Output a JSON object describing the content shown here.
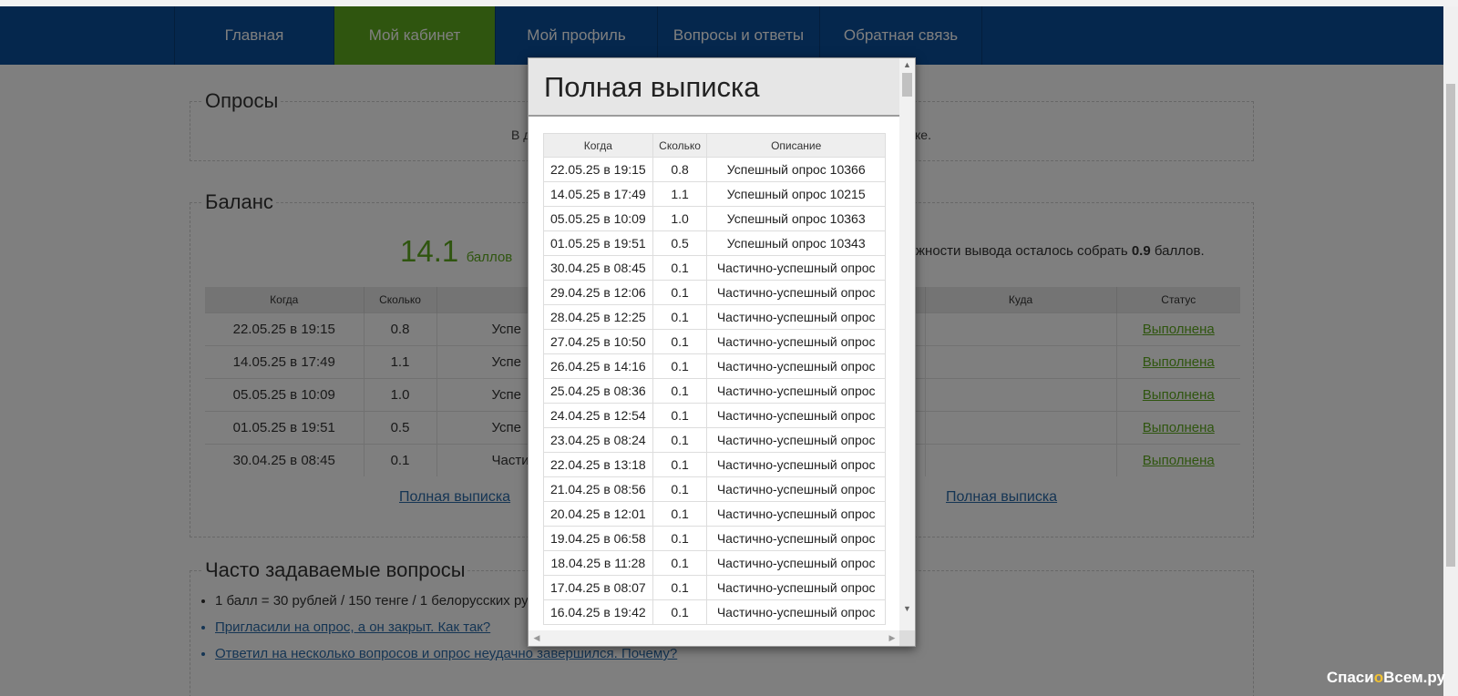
{
  "nav": [
    "Главная",
    "Мой кабинет",
    "Мой профиль",
    "Вопросы и ответы",
    "Обратная связь"
  ],
  "surveys": {
    "legend": "Опросы",
    "text_left": "В д",
    "text_right": "ке."
  },
  "balance": {
    "legend": "Баланс",
    "amount": "14.1",
    "unit": "баллов",
    "note_prefix": "жности вывода осталось собрать ",
    "note_value": "0.9",
    "note_suffix": " баллов.",
    "left_headers": [
      "Когда",
      "Сколько",
      ""
    ],
    "right_headers": [
      "Куда",
      "Статус"
    ],
    "rows": [
      {
        "when": "22.05.25 в 19:15",
        "amount": "0.8",
        "desc": "Успе",
        "status": "Выполнена"
      },
      {
        "when": "14.05.25 в 17:49",
        "amount": "1.1",
        "desc": "Успе",
        "status": "Выполнена"
      },
      {
        "when": "05.05.25 в 10:09",
        "amount": "1.0",
        "desc": "Успе",
        "status": "Выполнена"
      },
      {
        "when": "01.05.25 в 19:51",
        "amount": "0.5",
        "desc": "Успе",
        "status": "Выполнена"
      },
      {
        "when": "30.04.25 в 08:45",
        "amount": "0.1",
        "desc": "Частич",
        "status": "Выполнена"
      }
    ],
    "full_statement_left": "Полная выписка",
    "full_statement_right": "Полная выписка"
  },
  "faq": {
    "legend": "Часто задаваемые вопросы",
    "items": [
      "1 балл = 30 рублей / 150 тенге / 1 белорусских ру",
      "Пригласили на опрос, а он закрыт. Как так?",
      "Ответил на несколько вопросов и опрос неудачно завершился. Почему?"
    ]
  },
  "modal": {
    "title": "Полная выписка",
    "headers": [
      "Когда",
      "Сколько",
      "Описание"
    ],
    "rows": [
      {
        "when": "22.05.25 в 19:15",
        "amount": "0.8",
        "desc": "Успешный опрос 10366"
      },
      {
        "when": "14.05.25 в 17:49",
        "amount": "1.1",
        "desc": "Успешный опрос 10215"
      },
      {
        "when": "05.05.25 в 10:09",
        "amount": "1.0",
        "desc": "Успешный опрос 10363"
      },
      {
        "when": "01.05.25 в 19:51",
        "amount": "0.5",
        "desc": "Успешный опрос 10343"
      },
      {
        "when": "30.04.25 в 08:45",
        "amount": "0.1",
        "desc": "Частично-успешный опрос"
      },
      {
        "when": "29.04.25 в 12:06",
        "amount": "0.1",
        "desc": "Частично-успешный опрос"
      },
      {
        "when": "28.04.25 в 12:25",
        "amount": "0.1",
        "desc": "Частично-успешный опрос"
      },
      {
        "when": "27.04.25 в 10:50",
        "amount": "0.1",
        "desc": "Частично-успешный опрос"
      },
      {
        "when": "26.04.25 в 14:16",
        "amount": "0.1",
        "desc": "Частично-успешный опрос"
      },
      {
        "when": "25.04.25 в 08:36",
        "amount": "0.1",
        "desc": "Частично-успешный опрос"
      },
      {
        "when": "24.04.25 в 12:54",
        "amount": "0.1",
        "desc": "Частично-успешный опрос"
      },
      {
        "when": "23.04.25 в 08:24",
        "amount": "0.1",
        "desc": "Частично-успешный опрос"
      },
      {
        "when": "22.04.25 в 13:18",
        "amount": "0.1",
        "desc": "Частично-успешный опрос"
      },
      {
        "when": "21.04.25 в 08:56",
        "amount": "0.1",
        "desc": "Частично-успешный опрос"
      },
      {
        "when": "20.04.25 в 12:01",
        "amount": "0.1",
        "desc": "Частично-успешный опрос"
      },
      {
        "when": "19.04.25 в 06:58",
        "amount": "0.1",
        "desc": "Частично-успешный опрос"
      },
      {
        "when": "18.04.25 в 11:28",
        "amount": "0.1",
        "desc": "Частично-успешный опрос"
      },
      {
        "when": "17.04.25 в 08:07",
        "amount": "0.1",
        "desc": "Частично-успешный опрос"
      },
      {
        "when": "16.04.25 в 19:42",
        "amount": "0.1",
        "desc": "Частично-успешный опрос"
      }
    ]
  },
  "watermark": {
    "part1": "Спаси",
    "part2": "о",
    "part3": "Всем.ру"
  },
  "colors": {
    "nav": "#0b4e9a",
    "active": "#5eaa1f",
    "balance": "#5eaa1f"
  }
}
